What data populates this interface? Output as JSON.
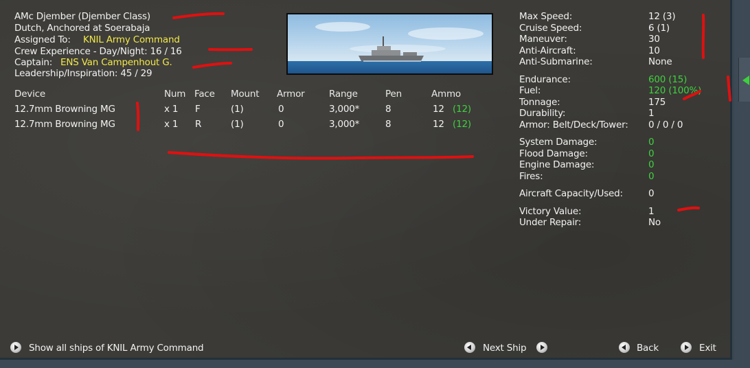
{
  "ship": {
    "name": "AMc Djember (Djember Class)",
    "status": "Dutch, Anchored at Soerabaja",
    "assigned_label": "Assigned To:",
    "assigned_value": "KNIL Army Command",
    "crew_exp": "Crew Experience - Day/Night: 16 / 16",
    "captain_label": "Captain:",
    "captain_value": "ENS Van Campenhout G.",
    "leadership": "Leadership/Inspiration: 45 / 29"
  },
  "devices": {
    "headers": {
      "device": "Device",
      "num": "Num",
      "face": "Face",
      "mount": "Mount",
      "armor": "Armor",
      "range": "Range",
      "pen": "Pen",
      "ammo": "Ammo"
    },
    "rows": [
      {
        "device": "12.7mm Browning MG",
        "num": "x 1",
        "face": "F",
        "mount": "(1)",
        "armor": "0",
        "range": "3,000*",
        "pen": "8",
        "ammo": "12",
        "ammo_max": "(12)"
      },
      {
        "device": "12.7mm Browning MG",
        "num": "x 1",
        "face": "R",
        "mount": "(1)",
        "armor": "0",
        "range": "3,000*",
        "pen": "8",
        "ammo": "12",
        "ammo_max": "(12)"
      }
    ]
  },
  "stats": {
    "max_speed": {
      "label": "Max Speed:",
      "value": "12 (3)"
    },
    "cruise_speed": {
      "label": "Cruise Speed:",
      "value": "6 (1)"
    },
    "maneuver": {
      "label": "Maneuver:",
      "value": "30"
    },
    "anti_aircraft": {
      "label": "Anti-Aircraft:",
      "value": "10"
    },
    "anti_submarine": {
      "label": "Anti-Submarine:",
      "value": "None"
    },
    "endurance": {
      "label": "Endurance:",
      "value": "600 (15)"
    },
    "fuel": {
      "label": "Fuel:",
      "value": "120 (100%)"
    },
    "tonnage": {
      "label": "Tonnage:",
      "value": "175"
    },
    "durability": {
      "label": "Durability:",
      "value": "1"
    },
    "armor": {
      "label": "Armor: Belt/Deck/Tower:",
      "value": "0 / 0 / 0"
    },
    "system_damage": {
      "label": "System Damage:",
      "value": "0"
    },
    "flood_damage": {
      "label": "Flood Damage:",
      "value": "0"
    },
    "engine_damage": {
      "label": "Engine Damage:",
      "value": "0"
    },
    "fires": {
      "label": "Fires:",
      "value": "0"
    },
    "aircraft": {
      "label": "Aircraft Capacity/Used:",
      "value": "0"
    },
    "victory_value": {
      "label": "Victory Value:",
      "value": "1"
    },
    "under_repair": {
      "label": "Under Repair:",
      "value": "No"
    }
  },
  "footer": {
    "show_all": "Show all ships of KNIL Army Command",
    "next_ship": "Next Ship",
    "back": "Back",
    "exit": "Exit"
  },
  "colors": {
    "background": "#3c3b37",
    "highlight_yellow": "#f2e84b",
    "highlight_green": "#3fd23f",
    "annotation_red": "#e01010"
  }
}
